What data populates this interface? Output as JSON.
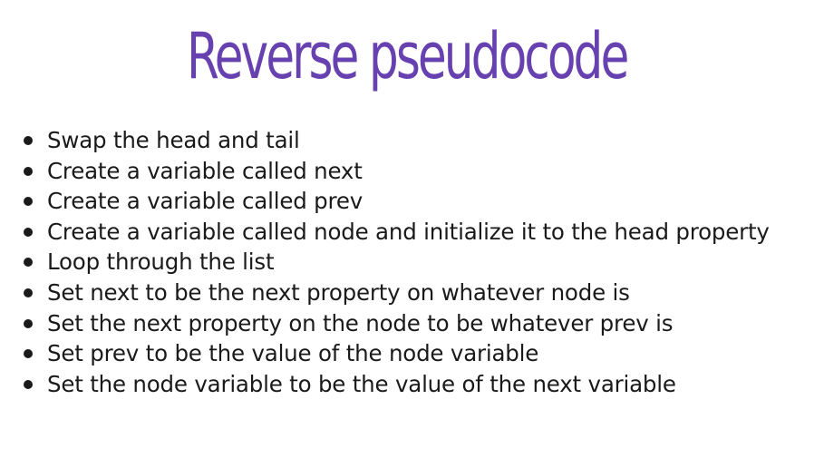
{
  "slide": {
    "title": "Reverse pseudocode",
    "bullets": [
      "Swap the head and tail",
      "Create a variable called next",
      "Create a variable called prev",
      "Create a variable called node and initialize it to the head property",
      "Loop through the list",
      "Set next to be the next property on whatever node is",
      "Set the next property on the node to be whatever prev is",
      "Set prev to be the value of the node variable",
      "Set the node variable to be the value of the next variable"
    ]
  },
  "colors": {
    "title": "#6741b0",
    "text": "#1a1a1a",
    "background": "#ffffff"
  }
}
